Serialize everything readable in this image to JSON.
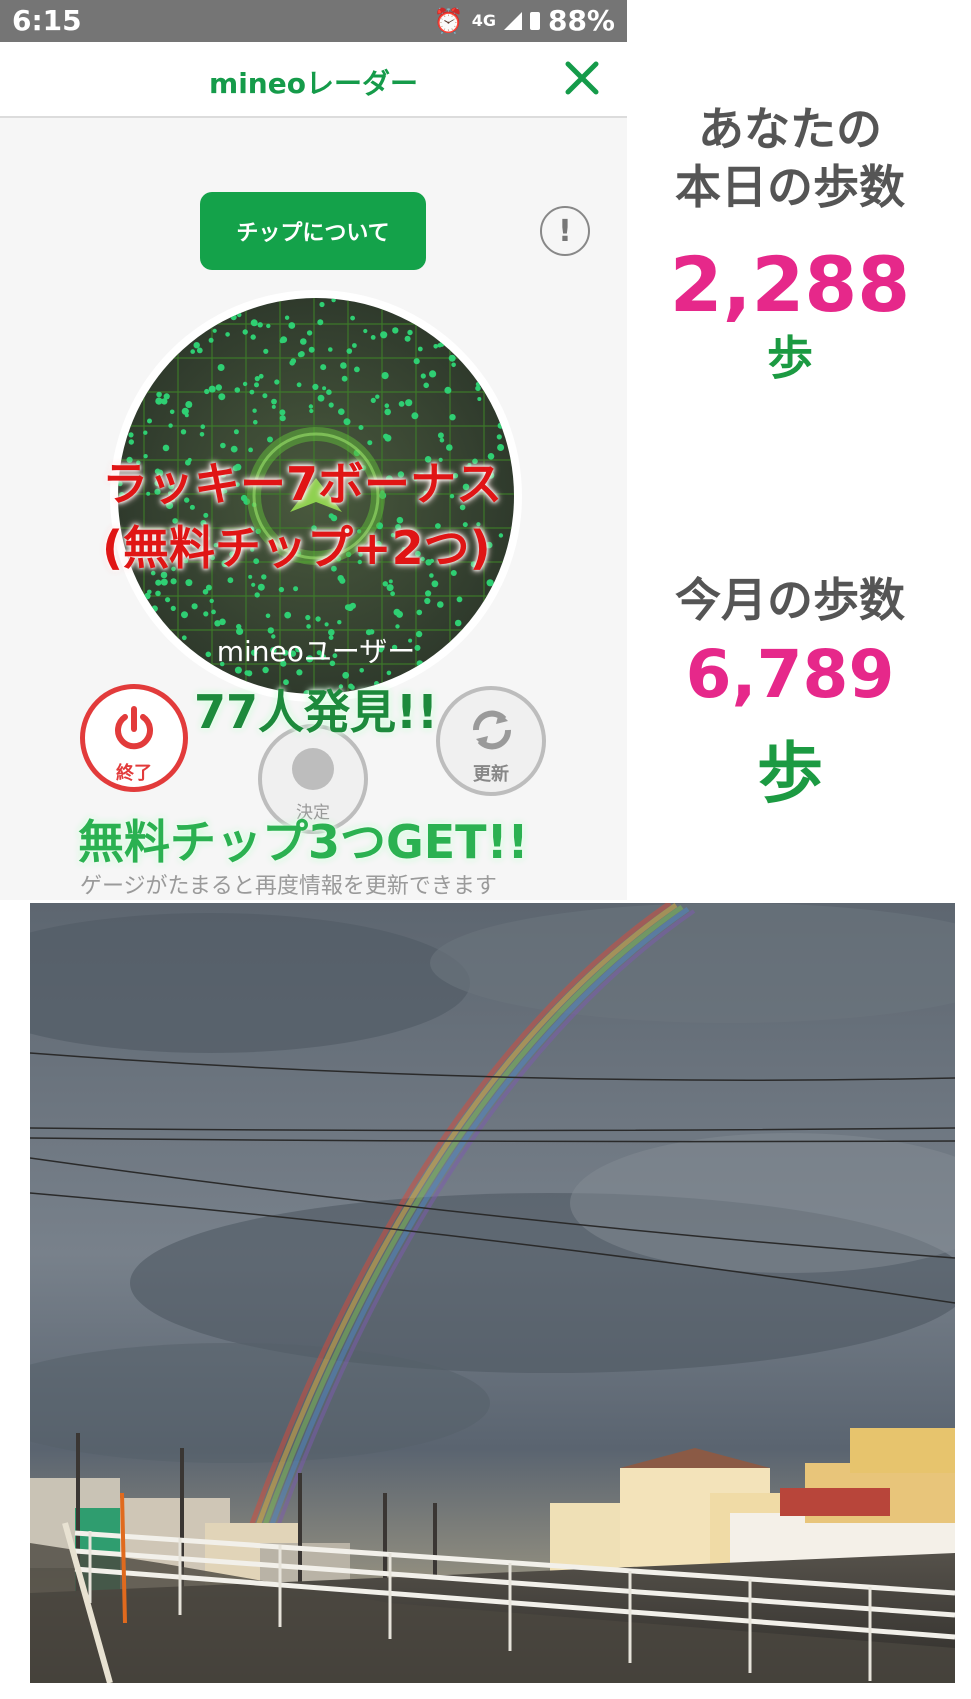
{
  "status_bar": {
    "time": "6:15",
    "network": "4G",
    "battery": "88%"
  },
  "header": {
    "title": "mineoレーダー",
    "close_icon": "close-icon"
  },
  "chip_button": {
    "label": "チップについて"
  },
  "info_icon": {
    "glyph": "!"
  },
  "bonus": {
    "line1": "ラッキー7ボーナス",
    "line2": "(無料チップ+2つ)"
  },
  "radar": {
    "users_label": "mineoユーザー",
    "found_text": "77人発見!!"
  },
  "controls": {
    "end_label": "終了",
    "decide_label": "決定",
    "refresh_label": "更新"
  },
  "free_chips_text": "無料チップ3つGET!!",
  "gauge_note": "ゲージがたまると再度情報を更新できます",
  "today": {
    "title_line1": "あなたの",
    "title_line2": "本日の歩数",
    "steps": "2,288",
    "unit": "歩"
  },
  "month": {
    "title": "今月の歩数",
    "steps": "6,789",
    "unit": "歩"
  },
  "colors": {
    "accent_green": "#14a24a",
    "step_pink": "#e6288a",
    "alert_red": "#e01515"
  }
}
